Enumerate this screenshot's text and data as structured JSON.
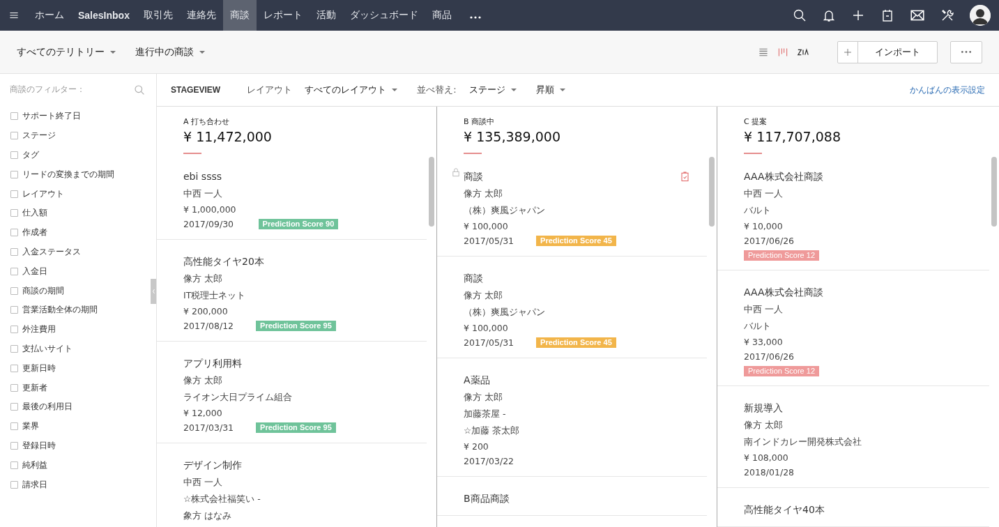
{
  "nav": {
    "items": [
      {
        "label": "ホーム",
        "selected": false,
        "bold": false
      },
      {
        "label": "SalesInbox",
        "selected": false,
        "bold": true
      },
      {
        "label": "取引先",
        "selected": false,
        "bold": false
      },
      {
        "label": "連絡先",
        "selected": false,
        "bold": false
      },
      {
        "label": "商談",
        "selected": true,
        "bold": false
      },
      {
        "label": "レポート",
        "selected": false,
        "bold": false
      },
      {
        "label": "活動",
        "selected": false,
        "bold": false
      },
      {
        "label": "ダッシュボード",
        "selected": false,
        "bold": false
      },
      {
        "label": "商品",
        "selected": false,
        "bold": false
      }
    ]
  },
  "subbar": {
    "territory": "すべてのテリトリー",
    "view": "進行中の商談",
    "import_button": "インポート"
  },
  "sidebar": {
    "title": "商談のフィルター：",
    "filters": [
      {
        "label": "サポート終了日",
        "checked": false
      },
      {
        "label": "ステージ",
        "checked": false
      },
      {
        "label": "タグ",
        "checked": false
      },
      {
        "label": "リードの変換までの期間",
        "checked": false
      },
      {
        "label": "レイアウト",
        "checked": false
      },
      {
        "label": "仕入額",
        "checked": false
      },
      {
        "label": "作成者",
        "checked": false
      },
      {
        "label": "入金ステータス",
        "checked": false
      },
      {
        "label": "入金日",
        "checked": false
      },
      {
        "label": "商談の期間",
        "checked": false
      },
      {
        "label": "営業活動全体の期間",
        "checked": false
      },
      {
        "label": "外注費用",
        "checked": false
      },
      {
        "label": "支払いサイト",
        "checked": false
      },
      {
        "label": "更新日時",
        "checked": false
      },
      {
        "label": "更新者",
        "checked": false
      },
      {
        "label": "最後の利用日",
        "checked": false
      },
      {
        "label": "業界",
        "checked": false
      },
      {
        "label": "登録日時",
        "checked": false
      },
      {
        "label": "純利益",
        "checked": false
      },
      {
        "label": "請求日",
        "checked": false
      }
    ]
  },
  "toolbar": {
    "view_name": "STAGEVIEW",
    "layout_label": "レイアウト",
    "layout_value": "すべてのレイアウト",
    "sort_label": "並べ替え:",
    "sort_value": "ステージ",
    "order_value": "昇順",
    "settings_link": "かんばんの表示設定"
  },
  "columns": [
    {
      "stage": "A 打ち合わせ",
      "total": "¥ 11,472,000",
      "cards": [
        {
          "kind": "inline",
          "title": "ebi ssss",
          "lines": [
            "中西 一人"
          ],
          "amount": "¥ 1,000,000",
          "date": "2017/09/30",
          "locked": false,
          "task": false,
          "badge": {
            "text": "Prediction Score 90",
            "color": "#6fc39a"
          }
        },
        {
          "kind": "inline",
          "title": "高性能タイヤ20本",
          "lines": [
            "像方 太郎",
            "IT税理士ネット"
          ],
          "amount": "¥ 200,000",
          "date": "2017/08/12",
          "locked": false,
          "task": false,
          "badge": {
            "text": "Prediction Score 95",
            "color": "#6fc39a"
          }
        },
        {
          "kind": "inline",
          "title": "アプリ利用料",
          "lines": [
            "像方 太郎",
            "ライオン大日プライム組合"
          ],
          "amount": "¥ 12,000",
          "date": "2017/03/31",
          "locked": false,
          "task": false,
          "badge": {
            "text": "Prediction Score 95",
            "color": "#6fc39a"
          }
        },
        {
          "kind": "inline",
          "title": "デザイン制作",
          "lines": [
            "中西 一人",
            "☆株式会社福笑い -",
            "象方 はなみ"
          ],
          "locked": false,
          "task": false
        }
      ]
    },
    {
      "stage": "B 商談中",
      "total": "¥ 135,389,000",
      "cards": [
        {
          "kind": "inline",
          "title": "商談",
          "lines": [
            "像方 太郎",
            "（株）爽風ジャパン"
          ],
          "amount": "¥ 100,000",
          "date": "2017/05/31",
          "locked": true,
          "task": true,
          "badge": {
            "text": "Prediction Score 45",
            "color": "#f2b54a"
          }
        },
        {
          "kind": "inline",
          "title": "商談",
          "lines": [
            "像方 太郎",
            "（株）爽風ジャパン"
          ],
          "amount": "¥ 100,000",
          "date": "2017/05/31",
          "locked": false,
          "task": false,
          "badge": {
            "text": "Prediction Score 45",
            "color": "#f2b54a"
          }
        },
        {
          "kind": "inline",
          "title": "A薬品",
          "lines": [
            "像方 太郎",
            "加藤茶屋 -",
            "☆加藤 茶太郎"
          ],
          "amount": "¥ 200",
          "date": "2017/03/22",
          "locked": false,
          "task": false
        },
        {
          "kind": "inline",
          "title": "B商品商談",
          "locked": false,
          "task": false
        }
      ]
    },
    {
      "stage": "C 提案",
      "total": "¥ 117,707,088",
      "cards": [
        {
          "kind": "stacked",
          "title": "AAA株式会社商談",
          "lines": [
            "中西 一人",
            "バルト"
          ],
          "amount": "¥ 10,000",
          "date": "2017/06/26",
          "locked": false,
          "task": false,
          "badge": {
            "text": "Prediction Score 12",
            "color": "#ef9a9a"
          }
        },
        {
          "kind": "stacked",
          "title": "AAA株式会社商談",
          "lines": [
            "中西 一人",
            "バルト"
          ],
          "amount": "¥ 33,000",
          "date": "2017/06/26",
          "locked": false,
          "task": false,
          "badge": {
            "text": "Prediction Score 12",
            "color": "#ef9a9a"
          }
        },
        {
          "kind": "stacked",
          "title": "新規導入",
          "lines": [
            "像方 太郎",
            "南インドカレー開発株式会社"
          ],
          "amount": "¥ 108,000",
          "date": "2018/01/28",
          "locked": false,
          "task": false
        },
        {
          "kind": "stacked",
          "title": "高性能タイヤ40本",
          "locked": false,
          "task": false
        }
      ]
    }
  ]
}
